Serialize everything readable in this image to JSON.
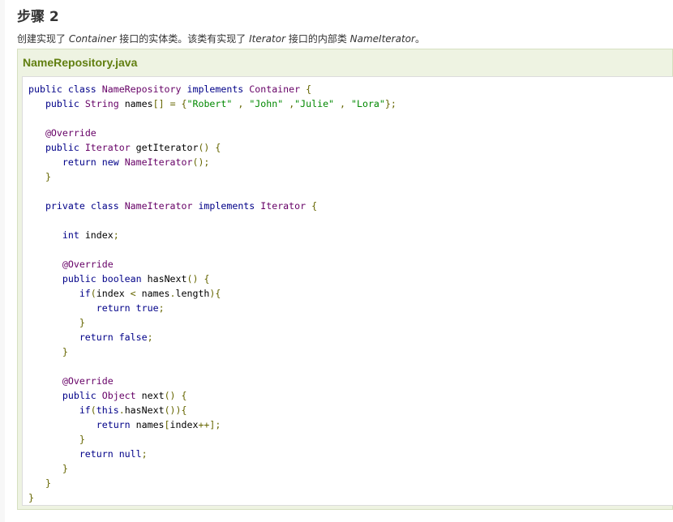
{
  "step_title": "步骤 2",
  "description": {
    "p1": "创建实现了 ",
    "i1": "Container",
    "p2": " 接口的实体类。该类有实现了 ",
    "i2": "Iterator",
    "p3": " 接口的内部类 ",
    "i3": "NameIterator",
    "p4": "。"
  },
  "example": {
    "title": "NameRepository.java",
    "code_lines": [
      "public class NameRepository implements Container {",
      "   public String names[] = {\"Robert\" , \"John\" ,\"Julie\" , \"Lora\"};",
      "",
      "   @Override",
      "   public Iterator getIterator() {",
      "      return new NameIterator();",
      "   }",
      "",
      "   private class NameIterator implements Iterator {",
      "",
      "      int index;",
      "",
      "      @Override",
      "      public boolean hasNext() {",
      "         if(index < names.length){",
      "            return true;",
      "         }",
      "         return false;",
      "      }",
      "",
      "      @Override",
      "      public Object next() {",
      "         if(this.hasNext()){",
      "            return names[index++];",
      "         }",
      "         return null;",
      "      }",
      "   }",
      "}"
    ]
  }
}
